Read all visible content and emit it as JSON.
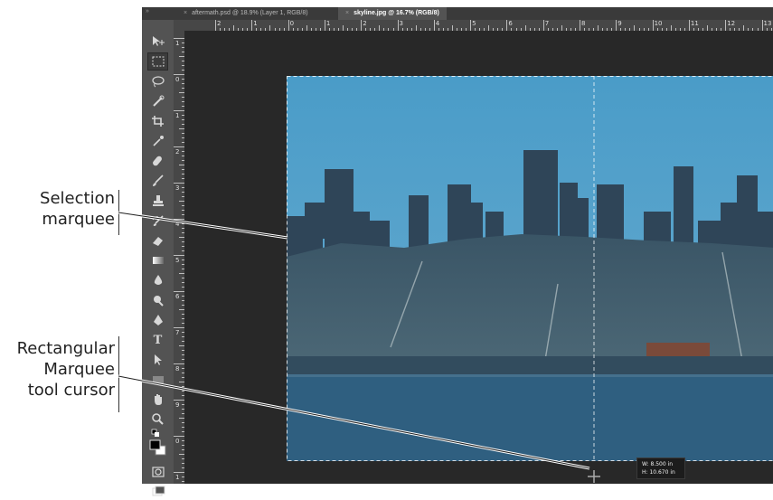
{
  "tabs": [
    {
      "label": "aftermath.psd @ 18.9% (Layer 1, RGB/8)",
      "active": false
    },
    {
      "label": "skyline.jpg @ 16.7% (RGB/8)",
      "active": true
    }
  ],
  "tab_close_glyph": "×",
  "panel_collapse_glyph": "»",
  "hruler_labels": [
    "2",
    "1",
    "0",
    "1",
    "2",
    "3",
    "4",
    "5",
    "6",
    "7",
    "8",
    "9",
    "10",
    "11",
    "12",
    "13"
  ],
  "vruler_labels": [
    "1",
    "0",
    "1",
    "2",
    "3",
    "4",
    "5",
    "6",
    "7",
    "8",
    "9",
    "0",
    "1"
  ],
  "tools": [
    {
      "icon": "move-icon",
      "selected": false
    },
    {
      "icon": "rectangular-marquee-icon",
      "selected": true
    },
    {
      "icon": "lasso-icon",
      "selected": false
    },
    {
      "icon": "quick-selection-icon",
      "selected": false
    },
    {
      "icon": "crop-icon",
      "selected": false
    },
    {
      "icon": "eyedropper-icon",
      "selected": false
    },
    {
      "icon": "spot-healing-brush-icon",
      "selected": false
    },
    {
      "icon": "brush-icon",
      "selected": false
    },
    {
      "icon": "clone-stamp-icon",
      "selected": false
    },
    {
      "icon": "history-brush-icon",
      "selected": false
    },
    {
      "icon": "eraser-icon",
      "selected": false
    },
    {
      "icon": "gradient-icon",
      "selected": false
    },
    {
      "icon": "blur-icon",
      "selected": false
    },
    {
      "icon": "dodge-icon",
      "selected": false
    },
    {
      "icon": "pen-icon",
      "selected": false
    },
    {
      "icon": "type-icon",
      "selected": false
    },
    {
      "icon": "path-selection-icon",
      "selected": false
    },
    {
      "icon": "rectangle-shape-icon",
      "selected": false
    },
    {
      "icon": "hand-icon",
      "selected": false
    },
    {
      "icon": "zoom-icon",
      "selected": false
    },
    {
      "icon": "default-colors-icon",
      "selected": false
    },
    {
      "icon": "color-swatches-icon",
      "selected": false
    },
    {
      "icon": "quick-mask-icon",
      "selected": false
    },
    {
      "icon": "screen-mode-icon",
      "selected": false
    }
  ],
  "type_tool_glyph": "T",
  "selection_readout": {
    "width": "W:  8.500 in",
    "height": "H: 10.670 in"
  },
  "callouts": {
    "selection_marquee": [
      "Selection",
      "marquee"
    ],
    "marquee_cursor": [
      "Rectangular",
      "Marquee",
      "tool cursor"
    ]
  },
  "colors": {
    "sky": "#4a9cc8",
    "water": "#2f5f80",
    "workspace": "#282828",
    "toolbar": "#535353",
    "foreground_swatch": "#000000",
    "background_swatch": "#ffffff"
  }
}
